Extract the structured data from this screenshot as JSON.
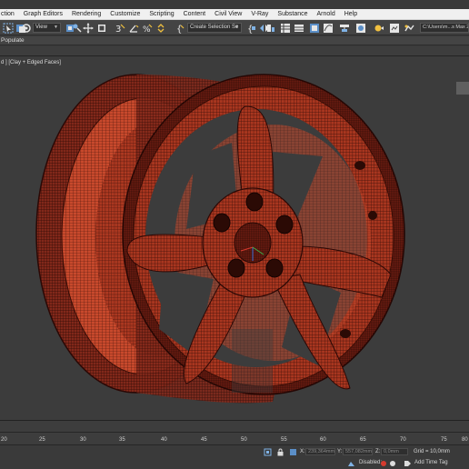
{
  "menu": {
    "items": [
      "ction",
      "Graph Editors",
      "Rendering",
      "Customize",
      "Scripting",
      "Content",
      "Civil View",
      "V-Ray",
      "Substance",
      "Arnold",
      "Help"
    ]
  },
  "toolbar": {
    "view_dropdown": "View",
    "selection_set": "Create Selection Se",
    "path_field": "C:\\Users\\m...s Max 20"
  },
  "ribbon": {
    "tab_label": "Populate"
  },
  "viewport": {
    "label": "d ] [Clay + Edged Faces]",
    "object": "alloy wheel rim",
    "object_color": "#b03a26",
    "background_color": "#3c3c3c"
  },
  "timeline": {
    "tick_labels": [
      "20",
      "25",
      "30",
      "35",
      "40",
      "45",
      "50",
      "55",
      "60",
      "65",
      "70",
      "75",
      "80"
    ]
  },
  "statusbar": {
    "x_label": "X:",
    "x_value": "239,364mm",
    "y_label": "Y:",
    "y_value": "557,082mm",
    "z_label": "Z:",
    "z_value": "0,0mm",
    "grid_label": "Grid = 10,0mm",
    "disabled_label": "Disabled:",
    "add_time_tag": "Add Time Tag"
  }
}
